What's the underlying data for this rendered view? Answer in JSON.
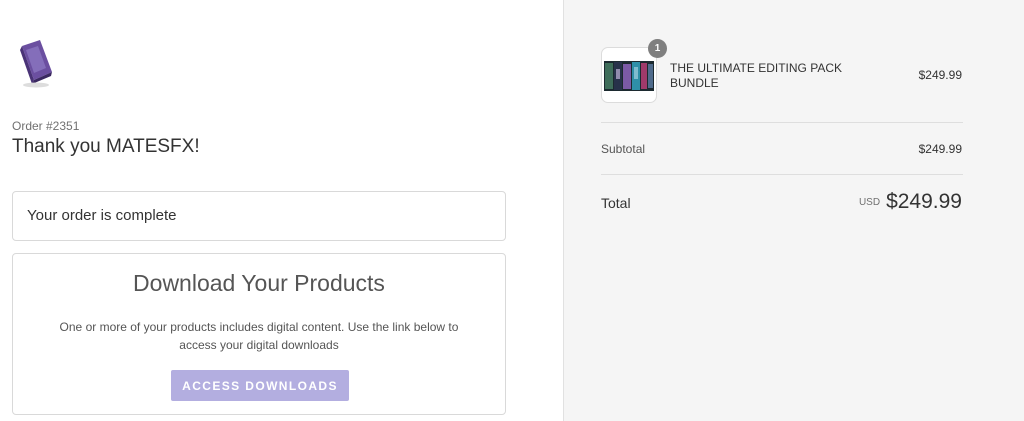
{
  "order": {
    "number": "Order #2351",
    "greeting": "Thank you MATESFX!",
    "status_text": "Your order is complete"
  },
  "downloads": {
    "title": "Download Your Products",
    "description": "One or more of your products includes digital content. Use the link below to access your digital downloads",
    "button_label": "ACCESS DOWNLOADS"
  },
  "summary": {
    "product": {
      "name": "THE ULTIMATE EDITING PACK BUNDLE",
      "quantity": "1",
      "price": "$249.99"
    },
    "subtotal_label": "Subtotal",
    "subtotal_value": "$249.99",
    "total_label": "Total",
    "currency": "USD",
    "total_value": "$249.99"
  },
  "colors": {
    "button_bg": "#b3aee0",
    "sidebar_bg": "#f5f5f5",
    "badge_bg": "#7f7f7f"
  },
  "icons": {
    "logo": "purple-box-logo",
    "product_thumbnail": "editing-pack-thumbnail"
  }
}
